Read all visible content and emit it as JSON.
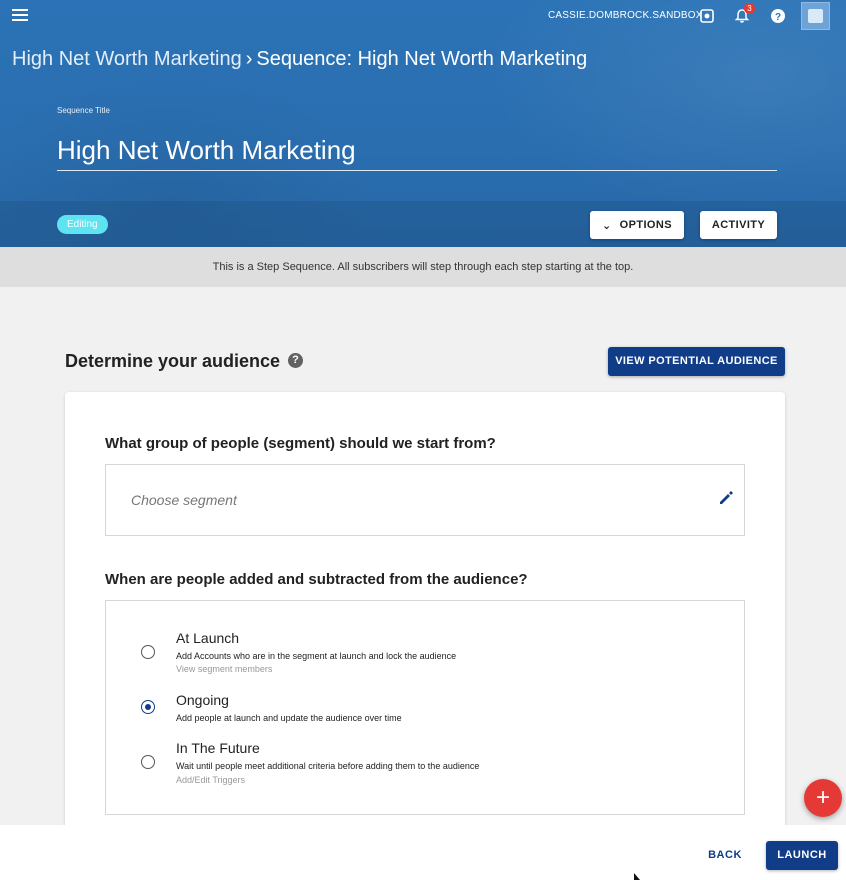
{
  "topbar": {
    "user_name": "CASSIE.DOMBROCK.SANDBOX",
    "notification_count": "3",
    "help_glyph": "?",
    "icons": [
      "menu-icon",
      "settings-icon",
      "bell-icon",
      "help-icon",
      "avatar"
    ]
  },
  "breadcrumb": {
    "parent": "High Net Worth Marketing",
    "separator": "›",
    "current": "Sequence: High Net Worth Marketing"
  },
  "sequence": {
    "label": "Sequence Title",
    "title": "High Net Worth Marketing",
    "status": "Editing"
  },
  "actions": {
    "options_label": "OPTIONS",
    "options_chevron": "⌄",
    "activity_label": "ACTIVITY"
  },
  "info_text": "This is a Step Sequence. All subscribers will step through each step starting at the top.",
  "audience": {
    "section_title": "Determine your audience",
    "help_glyph": "?",
    "view_button": "VIEW POTENTIAL AUDIENCE",
    "segment_question": "What group of people (segment) should we start from?",
    "segment_placeholder": "Choose segment",
    "timing_question": "When are people added and subtracted from the audience?",
    "options": [
      {
        "title": "At Launch",
        "description": "Add Accounts who are in the segment at launch and lock the audience",
        "link": "View segment members",
        "selected": false
      },
      {
        "title": "Ongoing",
        "description": "Add people at launch and update the audience over time",
        "selected": true
      },
      {
        "title": "In The Future",
        "description": "Wait until people meet additional criteria before adding them to the audience",
        "link": "Add/Edit Triggers",
        "selected": false
      }
    ]
  },
  "fab_label": "+",
  "footer": {
    "back_label": "BACK",
    "launch_label": "LAUNCH"
  },
  "colors": {
    "header_blue": "#2b73b6",
    "primary_navy": "#103c88",
    "editing_cyan": "#5ee3f0",
    "fab_red": "#e53935"
  }
}
